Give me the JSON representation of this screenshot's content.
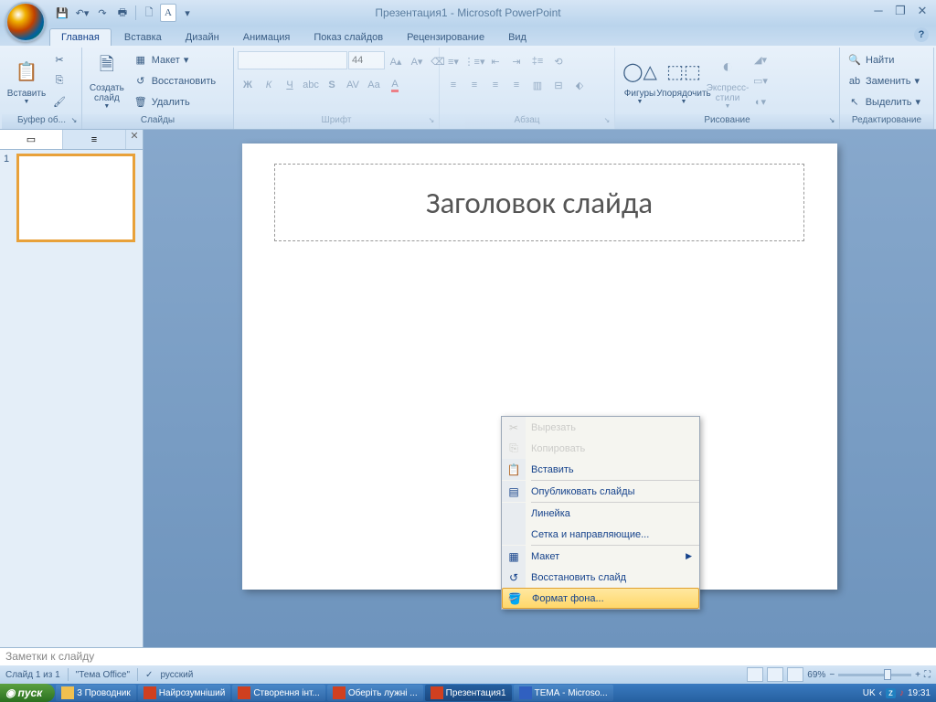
{
  "title": "Презентация1 - Microsoft PowerPoint",
  "qat_a_letter": "А",
  "tabs": [
    "Главная",
    "Вставка",
    "Дизайн",
    "Анимация",
    "Показ слайдов",
    "Рецензирование",
    "Вид"
  ],
  "groups": {
    "clipboard": {
      "label": "Буфер об...",
      "paste": "Вставить"
    },
    "slides": {
      "label": "Слайды",
      "new": "Создать слайд",
      "layout": "Макет",
      "reset": "Восстановить",
      "delete": "Удалить"
    },
    "font": {
      "label": "Шрифт",
      "size": "44"
    },
    "paragraph": {
      "label": "Абзац"
    },
    "drawing": {
      "label": "Рисование",
      "shapes": "Фигуры",
      "arrange": "Упорядочить",
      "quick": "Экспресс-стили"
    },
    "editing": {
      "label": "Редактирование",
      "find": "Найти",
      "replace": "Заменить",
      "select": "Выделить"
    }
  },
  "slide_title_placeholder": "Заголовок слайда",
  "thumb_num": "1",
  "notes_placeholder": "Заметки к слайду",
  "status": {
    "slide": "Слайд 1 из 1",
    "theme": "\"Тема Office\"",
    "lang": "русский",
    "zoom": "69%"
  },
  "ctx": {
    "cut": "Вырезать",
    "copy": "Копировать",
    "paste": "Вставить",
    "publish": "Опубликовать слайды",
    "ruler": "Линейка",
    "grid": "Сетка и направляющие...",
    "layout": "Макет",
    "reset": "Восстановить слайд",
    "format_bg": "Формат фона..."
  },
  "taskbar": {
    "start": "пуск",
    "items": [
      "3 Проводник",
      "Найрозумніший",
      "Створення інт...",
      "Оберіть лужні ...",
      "Презентация1",
      "ТЕМА - Microso..."
    ],
    "lang": "UK",
    "time": "19:31"
  }
}
